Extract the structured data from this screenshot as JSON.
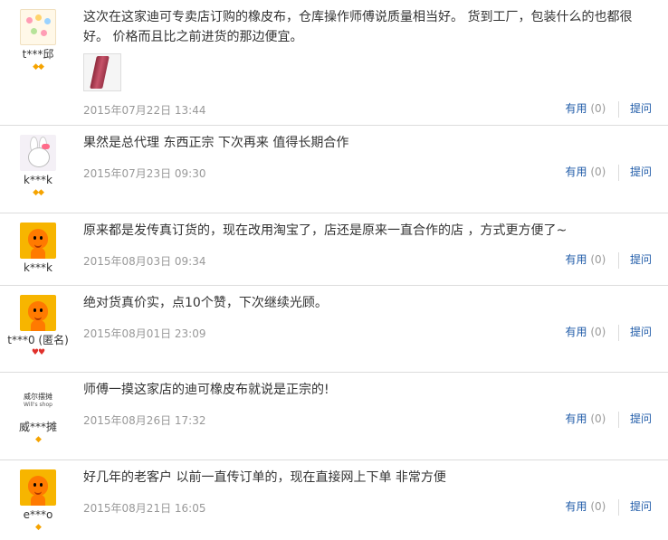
{
  "reviews": [
    {
      "user": "t***邱",
      "avatar_icon": "flower-avatar-icon",
      "badge": "◆◆",
      "badge_color": "gold",
      "text": "这次在这家迪可专卖店订购的橡皮布，仓库操作师傅说质量相当好。 货到工厂，包装什么的也都很好。 价格而且比之前进货的那边便宜。",
      "has_image": true,
      "date": "2015年07月22日 13:44",
      "useful_label": "有用",
      "useful_count": "(0)",
      "ask_label": "提问"
    },
    {
      "user": "k***k",
      "avatar_icon": "bunny-avatar-icon",
      "badge": "◆◆",
      "badge_color": "gold",
      "text": "果然是总代理 东西正宗 下次再来 值得长期合作",
      "has_image": false,
      "date": "2015年07月23日 09:30",
      "useful_label": "有用",
      "useful_count": "(0)",
      "ask_label": "提问"
    },
    {
      "user": "k***k",
      "avatar_icon": "taobao-doll-avatar-icon",
      "badge": "",
      "badge_color": "gold",
      "text": "原来都是发传真订货的，现在改用淘宝了，店还是原来一直合作的店 ，方式更方便了~",
      "has_image": false,
      "date": "2015年08月03日 09:34",
      "useful_label": "有用",
      "useful_count": "(0)",
      "ask_label": "提问"
    },
    {
      "user": "t***0 (匿名)",
      "avatar_icon": "taobao-doll-avatar-icon",
      "badge": "♥♥",
      "badge_color": "red",
      "text": "绝对货真价实，点10个赞，下次继续光顾。",
      "has_image": false,
      "date": "2015年08月01日 23:09",
      "useful_label": "有用",
      "useful_count": "(0)",
      "ask_label": "提问"
    },
    {
      "user": "威***摊",
      "avatar_icon": "shop-logo-avatar-icon",
      "avatar_text": "威尔摆摊",
      "avatar_subtext": "Will's shop",
      "badge": "◆",
      "badge_color": "gold",
      "text": "师傅一摸这家店的迪可橡皮布就说是正宗的!",
      "has_image": false,
      "date": "2015年08月26日 17:32",
      "useful_label": "有用",
      "useful_count": "(0)",
      "ask_label": "提问"
    },
    {
      "user": "e***o",
      "avatar_icon": "taobao-doll-avatar-icon",
      "badge": "◆",
      "badge_color": "gold",
      "text": "好几年的老客户 以前一直传订单的，现在直接网上下单 非常方便",
      "has_image": false,
      "date": "2015年08月21日 16:05",
      "useful_label": "有用",
      "useful_count": "(0)",
      "ask_label": "提问"
    }
  ],
  "colors": {
    "link": "#1f5ba8",
    "date": "#999999",
    "divider": "#dcdcdc",
    "badge_gold": "#f5a300",
    "badge_red": "#e0302b"
  }
}
